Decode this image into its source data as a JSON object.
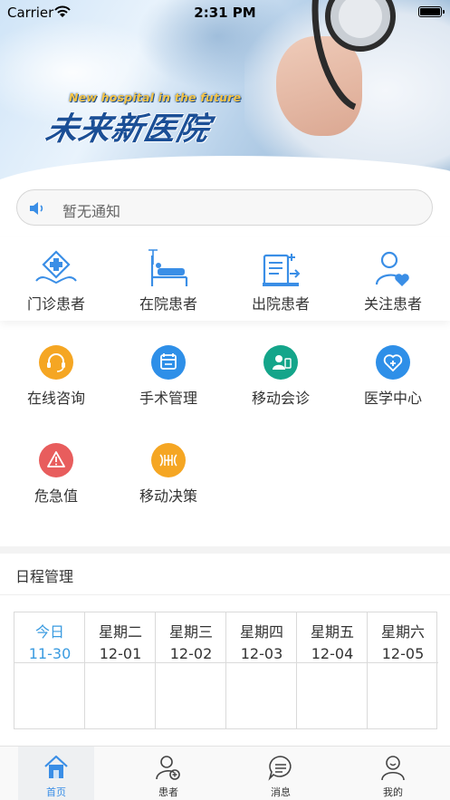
{
  "status_bar": {
    "carrier": "Carrier",
    "time": "2:31 PM"
  },
  "banner": {
    "logo_en": "New hospital in the future",
    "logo_cn": "未来新医院"
  },
  "notice": {
    "text": "暂无通知"
  },
  "grid": {
    "row1": [
      {
        "label": "门诊患者",
        "icon": "outpatient-icon"
      },
      {
        "label": "在院患者",
        "icon": "hospital-bed-icon"
      },
      {
        "label": "出院患者",
        "icon": "discharge-icon"
      },
      {
        "label": "关注患者",
        "icon": "follow-patient-icon"
      }
    ],
    "row2": [
      {
        "label": "在线咨询",
        "icon": "headset-icon",
        "color": "#f5a623"
      },
      {
        "label": "手术管理",
        "icon": "calendar-icon",
        "color": "#2e8fe8"
      },
      {
        "label": "移动会诊",
        "icon": "consult-icon",
        "color": "#14a58a"
      },
      {
        "label": "医学中心",
        "icon": "heart-plus-icon",
        "color": "#2e8fe8"
      }
    ],
    "row3": [
      {
        "label": "危急值",
        "icon": "warning-icon",
        "color": "#e85d5d"
      },
      {
        "label": "移动决策",
        "icon": "dna-icon",
        "color": "#f5a623"
      }
    ]
  },
  "schedule": {
    "title": "日程管理",
    "days": [
      {
        "day": "今日",
        "date": "11-30"
      },
      {
        "day": "星期二",
        "date": "12-01"
      },
      {
        "day": "星期三",
        "date": "12-02"
      },
      {
        "day": "星期四",
        "date": "12-03"
      },
      {
        "day": "星期五",
        "date": "12-04"
      },
      {
        "day": "星期六",
        "date": "12-05"
      }
    ]
  },
  "tabbar": [
    {
      "label": "首页",
      "icon": "home-icon",
      "active": true
    },
    {
      "label": "患者",
      "icon": "patient-icon"
    },
    {
      "label": "消息",
      "icon": "message-icon"
    },
    {
      "label": "我的",
      "icon": "profile-icon"
    }
  ],
  "colors": {
    "accent": "#3a8ee6",
    "today": "#3a9be0"
  }
}
